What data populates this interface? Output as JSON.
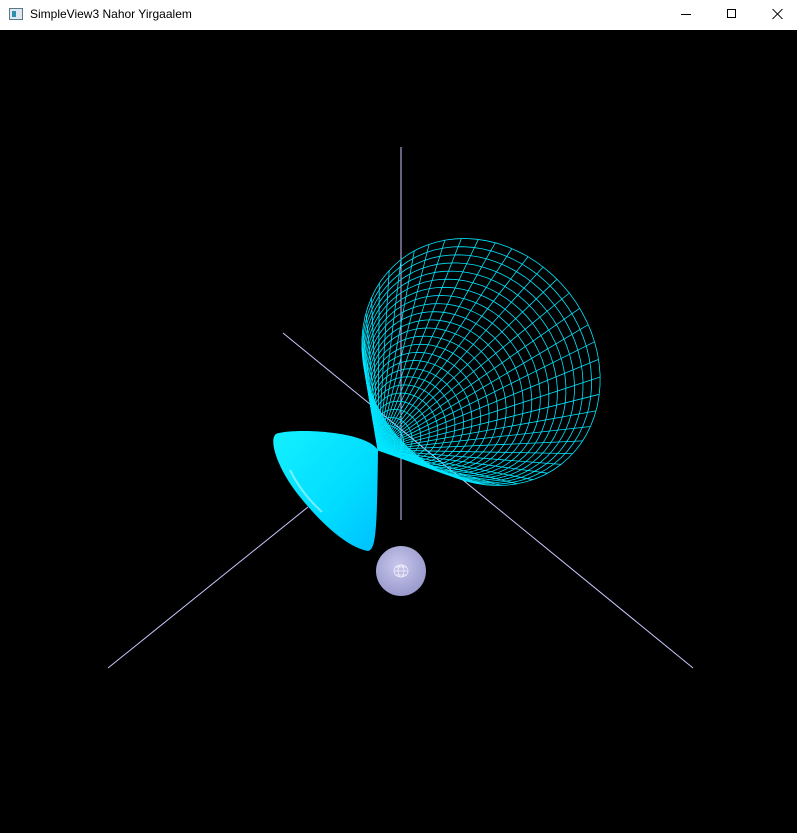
{
  "window": {
    "title": "SimpleView3 Nahor Yirgaalem"
  },
  "icons": {
    "app": "app-window-icon",
    "minimize": "minimize-icon",
    "maximize": "maximize-icon",
    "close": "close-icon"
  },
  "scene": {
    "background": "#000000",
    "axis_color": "#c8c8ff",
    "surface_color": "#00e5ff",
    "sphere_color": "#a8a8d8"
  }
}
